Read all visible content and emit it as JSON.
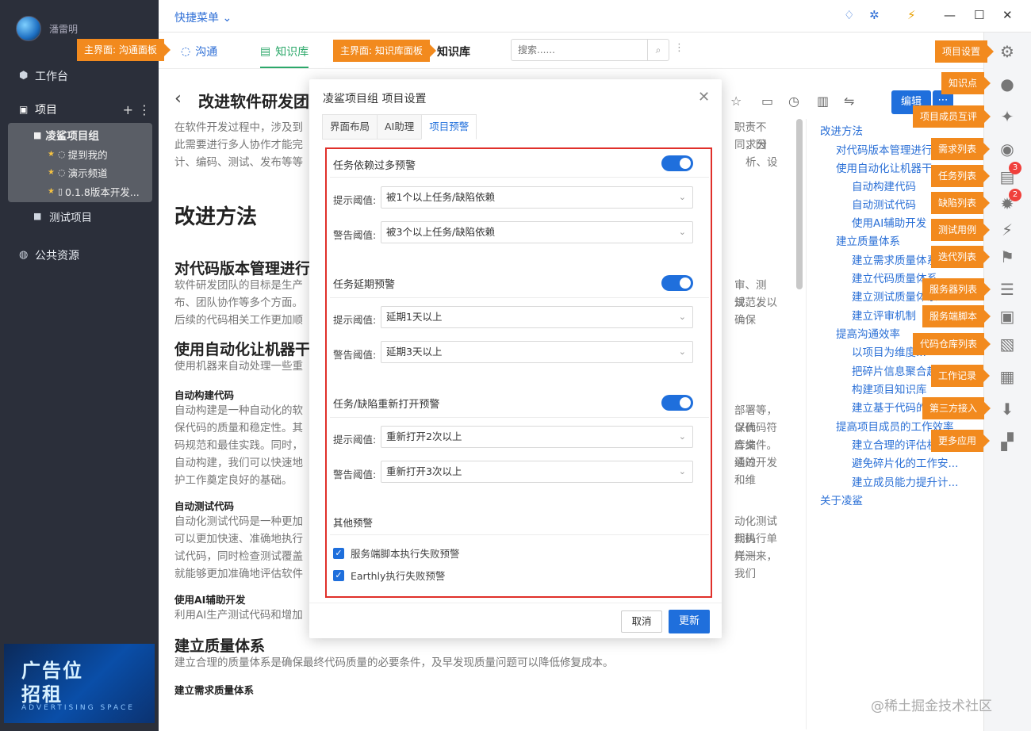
{
  "user": {
    "name": "潘雷明"
  },
  "sidebar": {
    "workspace": "工作台",
    "projects": "项目",
    "project_group": "凌鲨项目组",
    "children": [
      "提到我的",
      "演示频道",
      "0.1.8版本开发..."
    ],
    "test_project": "测试项目",
    "public": "公共资源"
  },
  "ad": {
    "line1": "广告位",
    "line2": "招租",
    "line3": "ADVERTISING SPACE"
  },
  "topbar": {
    "quick_menu": "快捷菜单"
  },
  "tabs": {
    "chat": "沟通",
    "kb": "知识库",
    "kb_title": "知识库"
  },
  "search": {
    "placeholder": "搜索......"
  },
  "tags": {
    "chat_panel": "主界面: 沟通面板",
    "kb_panel": "主界面: 知识库面板",
    "project_settings": "项目设置",
    "knowledge_point": "知识点",
    "peer_review": "项目成员互评",
    "requirements": "需求列表",
    "tasks": "任务列表",
    "bugs": "缺陷列表",
    "test_cases": "测试用例",
    "sprints": "迭代列表",
    "servers": "服务器列表",
    "server_scripts": "服务端脚本",
    "repos": "代码仓库列表",
    "work_log": "工作记录",
    "third_party": "第三方接入",
    "more_apps": "更多应用"
  },
  "badges": {
    "tasks": "3",
    "bugs": "2"
  },
  "doc": {
    "title": "改进软件研发团",
    "edit": "编辑",
    "intro_l1": "在软件开发过程中，涉及到",
    "intro_l1_r": "职责不同，因",
    "intro_l2": "此需要进行多人协作才能完",
    "intro_l2_r": "求分析、设",
    "intro_l3": "计、编码、测试、发布等等",
    "h_improve": "改进方法",
    "h_vcs": "对代码版本管理进行",
    "vcs_l1": "软件研发团队的目标是生产",
    "vcs_l1_r": "审、测试、发",
    "vcs_l2": "布、团队协作等多个方面。",
    "vcs_l2_r": "规范，以确保",
    "vcs_l3": "后续的代码相关工作更加顺",
    "h_auto": "使用自动化让机器干",
    "auto_l1": "使用机器来自动处理一些重",
    "h_build": "自动构建代码",
    "build_l1": "自动构建是一种自动化的软",
    "build_l1_r": "部署等，以确",
    "build_l2": "保代码的质量和稳定性。其",
    "build_l2_r": "保代码符合编",
    "build_l3": "码规范和最佳实践。同时，",
    "build_l3_r": "库文件。通过",
    "build_l4": "自动构建，我们可以快速地",
    "build_l4_r": "续的开发和维",
    "build_l5": "护工作奠定良好的基础。",
    "h_test": "自动测试代码",
    "test_l1": "自动化测试代码是一种更加",
    "test_l1_r": "动化测试代码",
    "test_l2": "可以更加快速、准确地执行",
    "test_l2_r": "期执行单元测",
    "test_l3": "试代码，同时检查测试覆盖",
    "test_l3_r": "样一来，我们",
    "test_l4": "就能够更加准确地评估软件",
    "h_ai": "使用AI辅助开发",
    "ai_l1": "利用AI生产测试代码和增加",
    "h_quality": "建立质量体系",
    "quality_l1": "建立合理的质量体系是确保最终代码质量的必要条件，及早发现质量问题可以降低修复成本。",
    "h_req": "建立需求质量体系"
  },
  "toc": [
    "改进方法",
    "对代码版本管理进行...",
    "使用自动化让机器干...",
    "自动构建代码",
    "自动测试代码",
    "使用AI辅助开发",
    "建立质量体系",
    "建立需求质量体系",
    "建立代码质量体系",
    "建立测试质量体系",
    "建立评审机制",
    "提高沟通效率",
    "以项目为维度...",
    "把碎片信息聚合起...",
    "构建项目知识库",
    "建立基于代码的...",
    "提高项目成员的工作效率",
    "建立合理的评估机...",
    "避免碎片化的工作安...",
    "建立成员能力提升计...",
    "关于凌鲨"
  ],
  "modal": {
    "title": "凌鲨项目组 项目设置",
    "tabs": [
      "界面布局",
      "AI助理",
      "项目预警"
    ],
    "sec1": "任务依赖过多预警",
    "sec2": "任务延期预警",
    "sec3": "任务/缺陷重新打开预警",
    "sec4": "其他预警",
    "hint_label": "提示阈值:",
    "warn_label": "警告阈值:",
    "s1_hint": "被1个以上任务/缺陷依赖",
    "s1_warn": "被3个以上任务/缺陷依赖",
    "s2_hint": "延期1天以上",
    "s2_warn": "延期3天以上",
    "s3_hint": "重新打开2次以上",
    "s3_warn": "重新打开3次以上",
    "chk1": "服务端脚本执行失败预警",
    "chk2": "Earthly执行失败预警",
    "cancel": "取消",
    "update": "更新"
  },
  "watermark": "@稀土掘金技术社区",
  "colors": {
    "primary": "#1f6fdc",
    "tag": "#f28a1e",
    "sidebar": "#2b2f3a",
    "highlight": "#e0302a",
    "kb_tab": "#2ca86a"
  }
}
